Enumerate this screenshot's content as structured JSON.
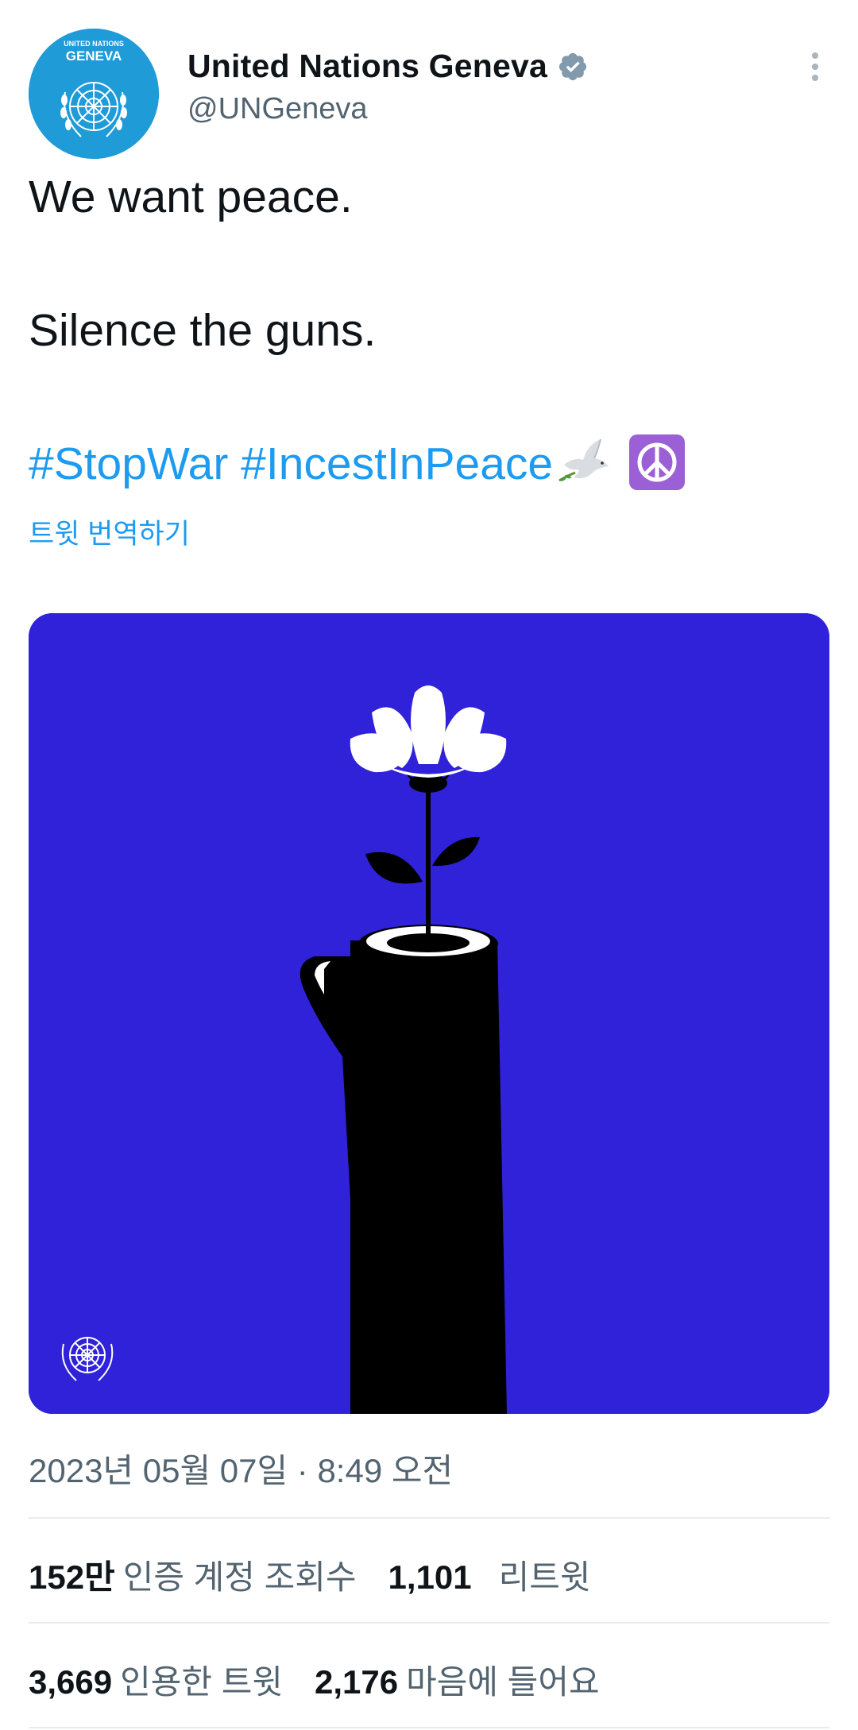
{
  "author": {
    "display_name": "United Nations Geneva",
    "handle": "@UNGeneva",
    "avatar_top_text": "UNITED NATIONS",
    "avatar_main_text": "GENEVA",
    "verified": true
  },
  "tweet": {
    "line1": "We want peace.",
    "line2": "Silence the guns.",
    "hashtag1": "#StopWar",
    "hashtag2": "#IncestInPeace",
    "translate_label": "트윗 번역하기"
  },
  "media": {
    "background_color": "#2f22d8",
    "description_icon": "flower-in-gun-barrel"
  },
  "meta": {
    "timestamp": "2023년 05월 07일 · 8:49 오전"
  },
  "stats": {
    "views_number": "152만",
    "views_label": "인증 계정 조회수",
    "retweets_number": "1,101",
    "retweets_label": "리트윗",
    "quotes_number": "3,669",
    "quotes_label": "인용한 트윗",
    "likes_number": "2,176",
    "likes_label": "마음에 들어요"
  },
  "colors": {
    "link": "#1d9bf0",
    "secondary_text": "#536471",
    "avatar_bg": "#1f9bd8"
  }
}
